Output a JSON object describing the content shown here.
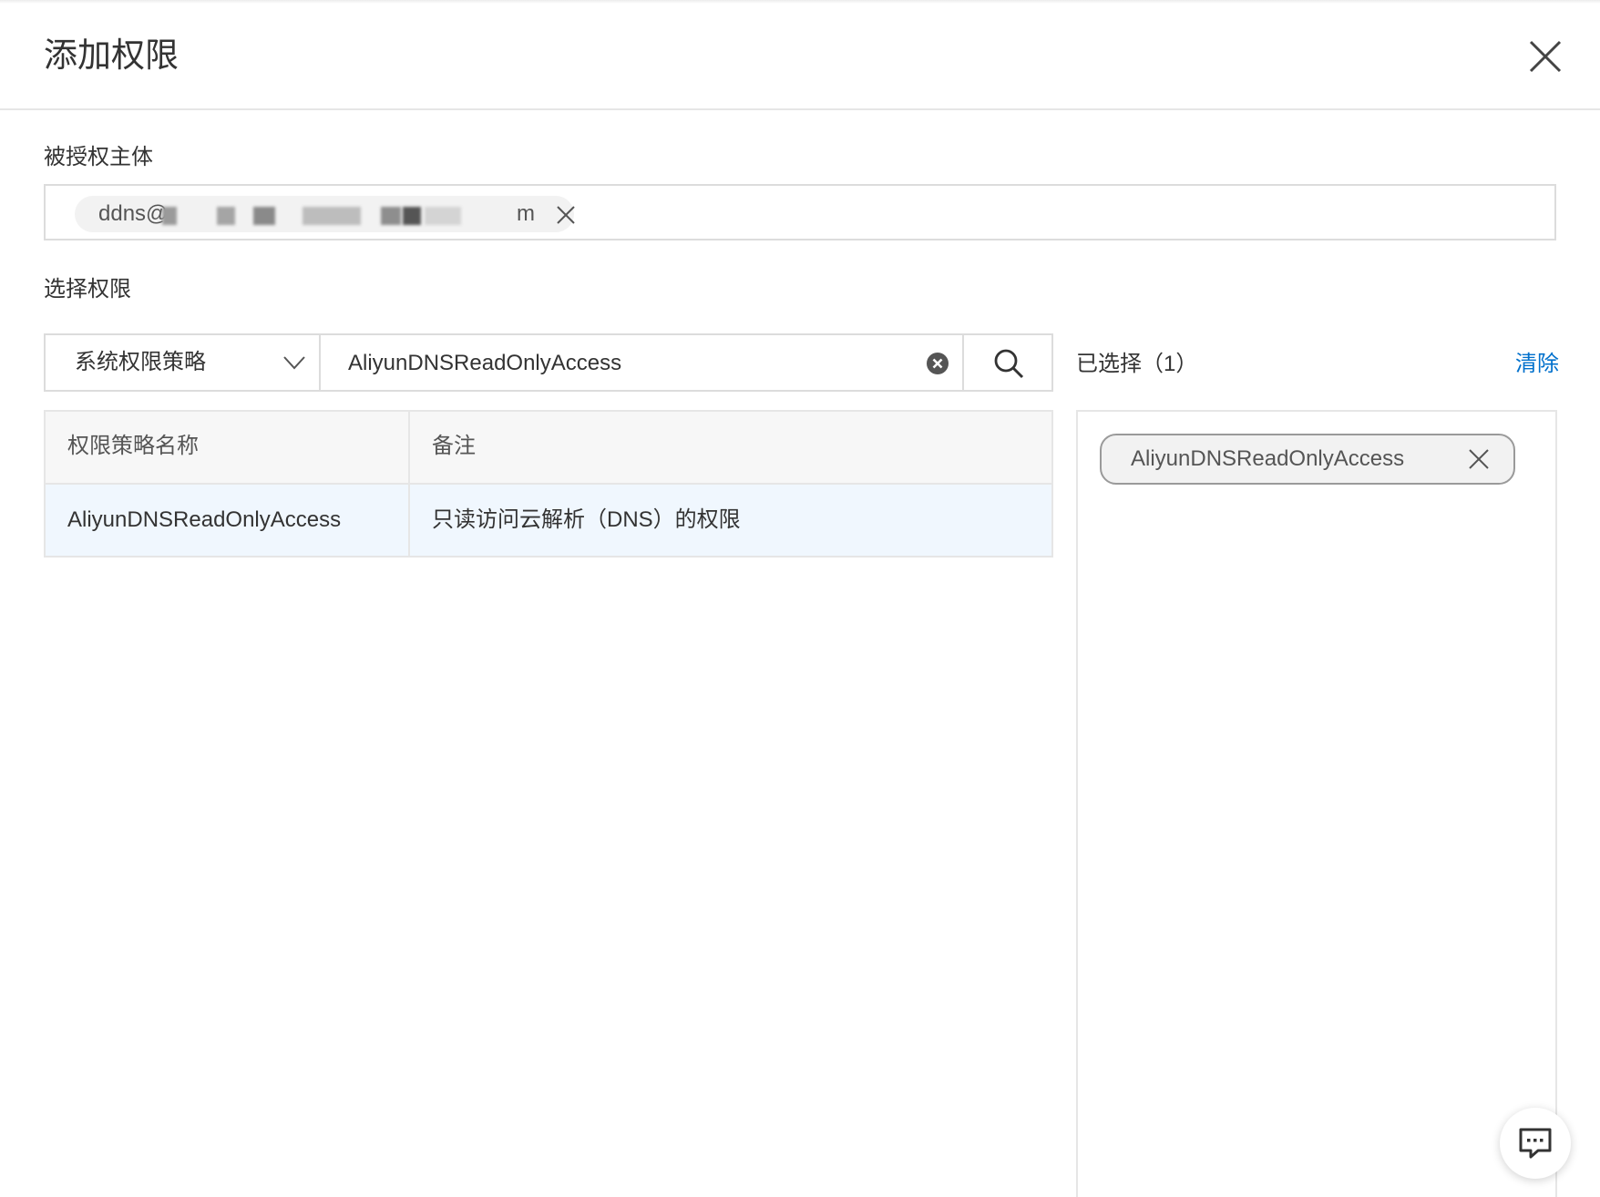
{
  "dialog": {
    "title": "添加权限",
    "close_icon": "close-icon"
  },
  "grantee": {
    "label": "被授权主体",
    "tag_prefix": "ddns@",
    "tag_suffix": "m",
    "remove_icon": "close-icon"
  },
  "permissions": {
    "label": "选择权限",
    "policy_type": "系统权限策略",
    "search_value": "AliyunDNSReadOnlyAccess",
    "clear_icon": "clear-circle-icon",
    "search_icon": "search-icon"
  },
  "table": {
    "headers": [
      "权限策略名称",
      "备注"
    ],
    "rows": [
      {
        "name": "AliyunDNSReadOnlyAccess",
        "note": "只读访问云解析（DNS）的权限"
      }
    ]
  },
  "selected": {
    "title": "已选择（1）",
    "clear_label": "清除",
    "items": [
      "AliyunDNSReadOnlyAccess"
    ]
  },
  "colors": {
    "link": "#0070cc",
    "selected_row": "#f0f7fe",
    "border": "#dcdcdc"
  },
  "chat": {
    "icon": "chat-icon"
  }
}
